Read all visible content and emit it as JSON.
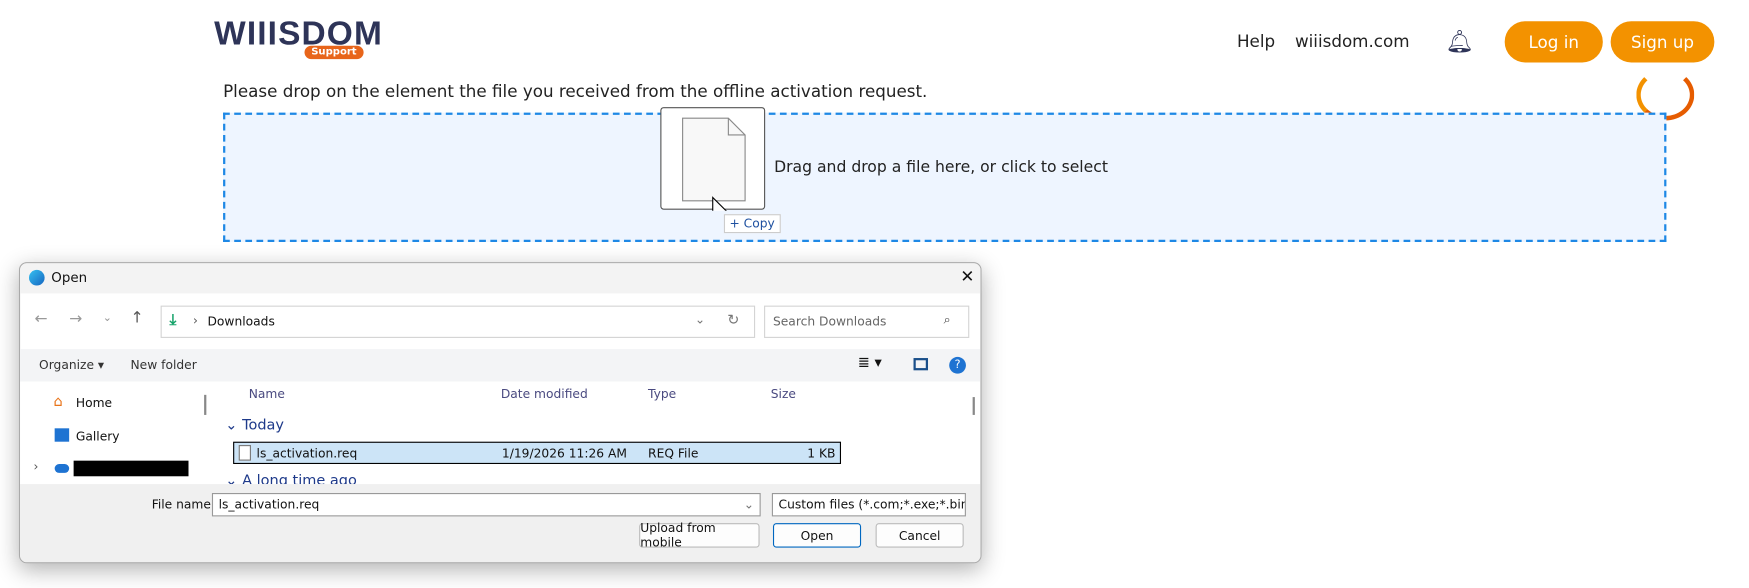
{
  "header": {
    "logo_text": "WIIISDOM",
    "logo_badge": "Support",
    "nav": [
      "Help",
      "wiiisdom.com"
    ],
    "login": "Log in",
    "signup": "Sign up"
  },
  "main": {
    "instruction": "Please drop on the element the file you received from the offline activation request.",
    "dropzone_text": "Drag and drop a file here, or click to select",
    "drag_badge": "+ Copy"
  },
  "dialog": {
    "title": "Open",
    "address": "Downloads",
    "search_placeholder": "Search Downloads",
    "organize": "Organize ▾",
    "new_folder": "New folder",
    "nav_items": [
      "Home",
      "Gallery"
    ],
    "columns": [
      "Name",
      "Date modified",
      "Type",
      "Size"
    ],
    "groups": [
      "Today",
      "A long time ago"
    ],
    "file": {
      "name": "ls_activation.req",
      "date": "1/19/2026 11:26 AM",
      "type": "REQ File",
      "size": "1 KB"
    },
    "file_name_label": "File name:",
    "file_name_value": "ls_activation.req",
    "filter": "Custom files (*.com;*.exe;*.bin;",
    "upload_mobile": "Upload from mobile",
    "open": "Open",
    "cancel": "Cancel"
  }
}
